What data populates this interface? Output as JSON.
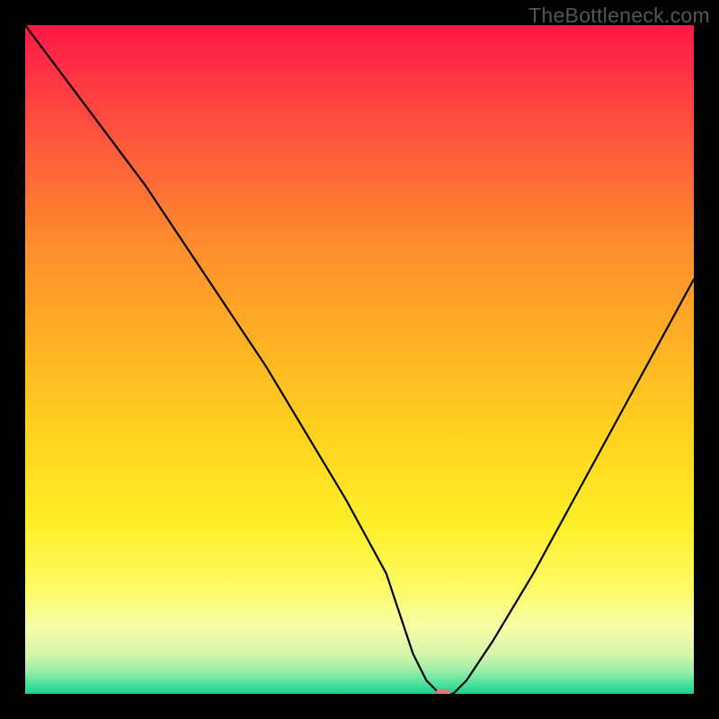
{
  "watermark": "TheBottleneck.com",
  "chart_data": {
    "type": "line",
    "title": "",
    "xlabel": "",
    "ylabel": "",
    "xlim": [
      0,
      100
    ],
    "ylim": [
      0,
      100
    ],
    "grid": false,
    "legend": false,
    "series": [
      {
        "name": "curve",
        "x": [
          0,
          6,
          12,
          18,
          24,
          30,
          36,
          42,
          48,
          54,
          56,
          58,
          60,
          62,
          64,
          66,
          70,
          76,
          82,
          88,
          94,
          100
        ],
        "values": [
          100,
          92,
          84,
          76,
          67,
          58,
          49,
          39,
          29,
          18,
          12,
          6,
          2,
          0,
          0,
          2,
          8,
          18,
          29,
          40,
          51,
          62
        ]
      }
    ],
    "marker": {
      "x": 62.5,
      "y": 0,
      "width": 2.4,
      "height": 1.4
    },
    "gradient_stops": [
      {
        "offset": 0.0,
        "color": "#ff1744"
      },
      {
        "offset": 0.05,
        "color": "#ff2a47"
      },
      {
        "offset": 0.18,
        "color": "#ff5a3c"
      },
      {
        "offset": 0.32,
        "color": "#ff8a2e"
      },
      {
        "offset": 0.48,
        "color": "#ffb224"
      },
      {
        "offset": 0.62,
        "color": "#ffd41f"
      },
      {
        "offset": 0.75,
        "color": "#ffef2a"
      },
      {
        "offset": 0.84,
        "color": "#fdfb65"
      },
      {
        "offset": 0.9,
        "color": "#f7fca6"
      },
      {
        "offset": 0.94,
        "color": "#d8f6aa"
      },
      {
        "offset": 0.965,
        "color": "#9ceea9"
      },
      {
        "offset": 0.985,
        "color": "#4fe29a"
      },
      {
        "offset": 1.0,
        "color": "#12d38c"
      }
    ]
  }
}
